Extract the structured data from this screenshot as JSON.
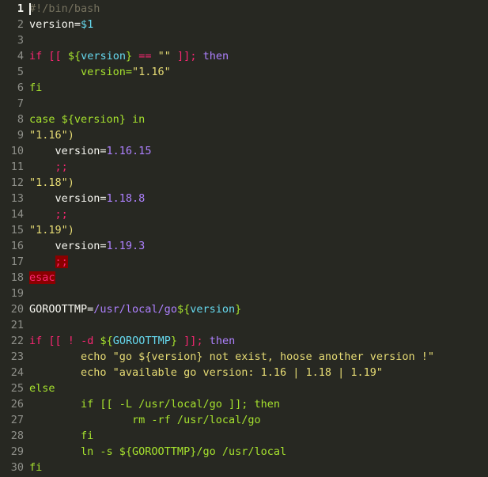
{
  "editor": {
    "active_line": 1,
    "lines": [
      {
        "n": "1",
        "tokens": [
          {
            "t": "#!/bin/bash",
            "c": "t-com"
          }
        ]
      },
      {
        "n": "2",
        "tokens": [
          {
            "t": "version=",
            "c": ""
          },
          {
            "t": "$1",
            "c": "t-var2"
          }
        ]
      },
      {
        "n": "3",
        "tokens": []
      },
      {
        "n": "4",
        "tokens": [
          {
            "t": "if",
            "c": "t-kw"
          },
          {
            "t": " ",
            "c": ""
          },
          {
            "t": "[[",
            "c": "t-kw"
          },
          {
            "t": " ",
            "c": ""
          },
          {
            "t": "${",
            "c": "t-var"
          },
          {
            "t": "version",
            "c": "t-var2"
          },
          {
            "t": "}",
            "c": "t-var"
          },
          {
            "t": " == ",
            "c": "t-kw"
          },
          {
            "t": "\"\"",
            "c": "t-str"
          },
          {
            "t": " ",
            "c": ""
          },
          {
            "t": "]]",
            "c": "t-kw"
          },
          {
            "t": "; ",
            "c": "t-kw"
          },
          {
            "t": "then",
            "c": "t-kw2"
          }
        ]
      },
      {
        "n": "5",
        "tokens": [
          {
            "t": "        version=",
            "c": "t-var"
          },
          {
            "t": "\"1.16\"",
            "c": "t-str"
          }
        ]
      },
      {
        "n": "6",
        "tokens": [
          {
            "t": "fi",
            "c": "t-var"
          }
        ]
      },
      {
        "n": "7",
        "tokens": []
      },
      {
        "n": "8",
        "tokens": [
          {
            "t": "case ${version} in",
            "c": "t-var"
          }
        ]
      },
      {
        "n": "9",
        "tokens": [
          {
            "t": "\"1.16\")",
            "c": "t-yel"
          }
        ]
      },
      {
        "n": "10",
        "tokens": [
          {
            "t": "    version=",
            "c": ""
          },
          {
            "t": "1.16.15",
            "c": "t-num"
          }
        ]
      },
      {
        "n": "11",
        "tokens": [
          {
            "t": "    ",
            "c": ""
          },
          {
            "t": ";;",
            "c": "t-kw"
          }
        ]
      },
      {
        "n": "12",
        "tokens": [
          {
            "t": "\"1.18\")",
            "c": "t-yel"
          }
        ]
      },
      {
        "n": "13",
        "tokens": [
          {
            "t": "    version=",
            "c": ""
          },
          {
            "t": "1.18.8",
            "c": "t-num"
          }
        ]
      },
      {
        "n": "14",
        "tokens": [
          {
            "t": "    ",
            "c": ""
          },
          {
            "t": ";;",
            "c": "t-kw"
          }
        ]
      },
      {
        "n": "15",
        "tokens": [
          {
            "t": "\"1.19\")",
            "c": "t-yel"
          }
        ]
      },
      {
        "n": "16",
        "tokens": [
          {
            "t": "    version=",
            "c": ""
          },
          {
            "t": "1.19.3",
            "c": "t-num"
          }
        ]
      },
      {
        "n": "17",
        "tokens": [
          {
            "t": "    ",
            "c": ""
          },
          {
            "t": ";;",
            "c": "t-err"
          }
        ]
      },
      {
        "n": "18",
        "tokens": [
          {
            "t": "esac",
            "c": "t-err-esac"
          }
        ]
      },
      {
        "n": "19",
        "tokens": []
      },
      {
        "n": "20",
        "tokens": [
          {
            "t": "GOROOTTMP=",
            "c": ""
          },
          {
            "t": "/usr/local/go",
            "c": "t-num"
          },
          {
            "t": "${",
            "c": "t-var"
          },
          {
            "t": "version",
            "c": "t-var2"
          },
          {
            "t": "}",
            "c": "t-var"
          }
        ]
      },
      {
        "n": "21",
        "tokens": []
      },
      {
        "n": "22",
        "tokens": [
          {
            "t": "if",
            "c": "t-kw"
          },
          {
            "t": " ",
            "c": ""
          },
          {
            "t": "[[",
            "c": "t-kw"
          },
          {
            "t": " ! ",
            "c": "t-kw"
          },
          {
            "t": "-d",
            "c": "t-kw"
          },
          {
            "t": " ",
            "c": ""
          },
          {
            "t": "${",
            "c": "t-var"
          },
          {
            "t": "GOROOTTMP",
            "c": "t-var2"
          },
          {
            "t": "}",
            "c": "t-var"
          },
          {
            "t": " ",
            "c": ""
          },
          {
            "t": "]]",
            "c": "t-kw"
          },
          {
            "t": "; ",
            "c": "t-kw"
          },
          {
            "t": "then",
            "c": "t-kw2"
          }
        ]
      },
      {
        "n": "23",
        "tokens": [
          {
            "t": "        echo \"go ${version} not exist, hoose another version !\"",
            "c": "t-yel"
          }
        ]
      },
      {
        "n": "24",
        "tokens": [
          {
            "t": "        echo \"available go version: 1.16 | 1.18 | 1.19\"",
            "c": "t-yel"
          }
        ]
      },
      {
        "n": "25",
        "tokens": [
          {
            "t": "else",
            "c": "t-var"
          }
        ]
      },
      {
        "n": "26",
        "tokens": [
          {
            "t": "        if [[ -L /usr/local/go ]]; then",
            "c": "t-var"
          }
        ]
      },
      {
        "n": "27",
        "tokens": [
          {
            "t": "                rm -rf /usr/local/go",
            "c": "t-var"
          }
        ]
      },
      {
        "n": "28",
        "tokens": [
          {
            "t": "        fi",
            "c": "t-var"
          }
        ]
      },
      {
        "n": "29",
        "tokens": [
          {
            "t": "        ln -s ${GOROOTTMP}/go /usr/local",
            "c": "t-var"
          }
        ]
      },
      {
        "n": "30",
        "tokens": [
          {
            "t": "fi",
            "c": "t-var"
          }
        ]
      }
    ]
  }
}
